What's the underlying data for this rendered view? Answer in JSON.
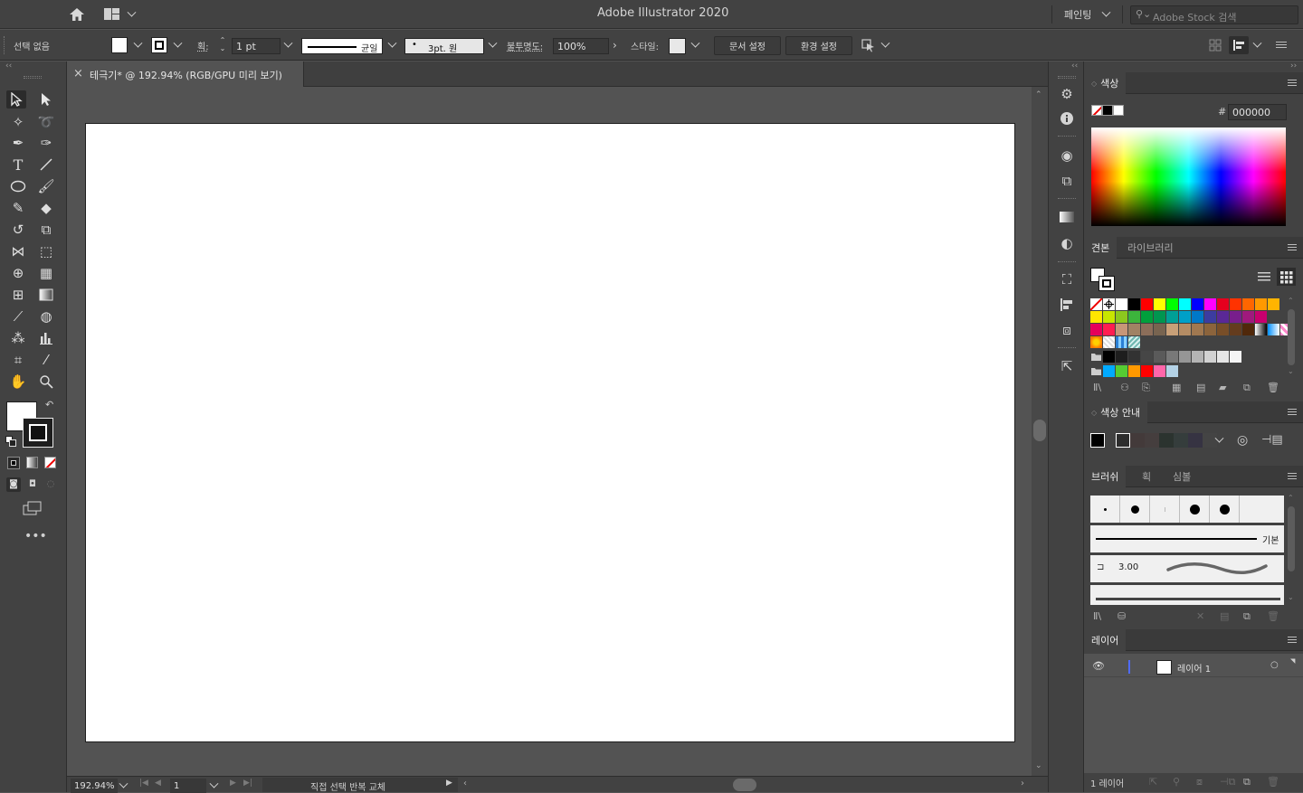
{
  "app": {
    "title": "Adobe Illustrator 2020"
  },
  "titlebar": {
    "workspace_label": "페인팅",
    "stock_search_placeholder": "Adobe Stock 검색"
  },
  "control_bar": {
    "selection_label": "선택 없음",
    "stroke_label": "획:",
    "stroke_weight": "1 pt",
    "stroke_profile": "균일",
    "brush_label": "3pt. 원",
    "opacity_label": "불투명도:",
    "opacity_value": "100%",
    "style_label": "스타일:",
    "doc_setup_button": "문서 설정",
    "preferences_button": "환경 설정"
  },
  "document_tab": {
    "close": "×",
    "title": "테극기* @ 192.94% (RGB/GPU 미리 보기)"
  },
  "status_bar": {
    "zoom": "192.94%",
    "artboard_number": "1",
    "status_text": "직접 선택 반복 교체"
  },
  "panels": {
    "color": {
      "title": "색상",
      "hex_symbol": "#",
      "hex_value": "000000"
    },
    "swatches": {
      "tab_active": "견본",
      "tab_other": "라이브러리"
    },
    "color_guide": {
      "title": "색상 안내"
    },
    "brushes": {
      "tab_active": "브러쉬",
      "tab_stroke": "획",
      "tab_symbols": "심볼",
      "basic_label": "기본",
      "size_value": "3.00"
    },
    "layers": {
      "title": "레이어",
      "layer_name": "레이어 1",
      "footer_count": "1 레이어"
    }
  },
  "colors": {
    "swatch_rows": [
      [
        "none",
        "reg",
        "#ffffff",
        "#000000",
        "#ff0000",
        "#ffff00",
        "#00ff00",
        "#00ffff",
        "#0000ff",
        "#ff00ff",
        "#e6001e",
        "#ff3300",
        "#ff6600",
        "#ff9900",
        "#ffb400"
      ],
      [
        "#ffe600",
        "#c8e600",
        "#8cc81e",
        "#3cb43c",
        "#00a03c",
        "#009650",
        "#00a096",
        "#00a0c8",
        "#0078c8",
        "#3c3ca0",
        "#5a2896",
        "#781e8c",
        "#a0197d",
        "#c8006e"
      ],
      [
        "#e6005a",
        "#ff1e50",
        "#c89678",
        "#a08264",
        "#8c6e5a",
        "#786450",
        "#c8a078",
        "#b48c64",
        "#a07850",
        "#8c643c",
        "#784e28",
        "#643c1e",
        "#50280a",
        "grad1",
        "grad2",
        "grad3"
      ],
      [
        "pat1",
        "pat2",
        "pat3",
        "pat4"
      ],
      [
        "folder",
        "#000000",
        "#1e1e1e",
        "#323232",
        "#464646",
        "#5a5a5a",
        "#787878",
        "#969696",
        "#b4b4b4",
        "#d2d2d2",
        "#e6e6e6",
        "#f5f5f5"
      ],
      [
        "folder",
        "#00aaff",
        "#55cc33",
        "#ff9900",
        "#ff0000",
        "#ff66aa",
        "#b4d2e6"
      ]
    ],
    "guide_swatches": [
      "#000000",
      "#2d2d2d",
      "#433a3a",
      "#453e3e",
      "#2b332f",
      "#353d3c",
      "#363342",
      "#444444"
    ]
  }
}
